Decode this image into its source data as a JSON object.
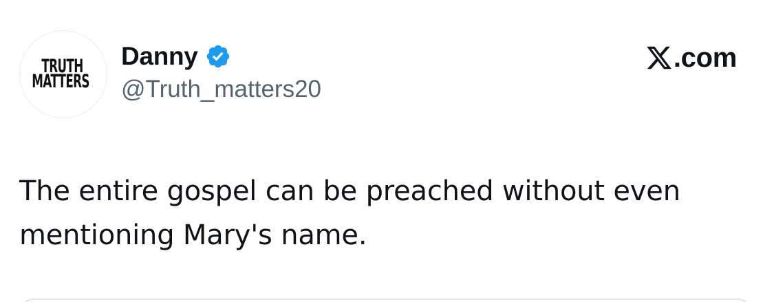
{
  "author": {
    "avatar_logo_text": [
      "TRUTH",
      "MATTERS"
    ],
    "display_name": "Danny",
    "handle": "@Truth_matters20",
    "verified": true,
    "verified_icon": "verified-badge-icon"
  },
  "brand": {
    "text": ".com",
    "logo_icon": "x-logo-icon"
  },
  "tweet": {
    "text": "The entire gospel can be preached without even mentioning Mary's name."
  },
  "colors": {
    "verified_blue": "#1d9bf0",
    "text_primary": "#0f1419",
    "text_secondary": "#536471"
  }
}
